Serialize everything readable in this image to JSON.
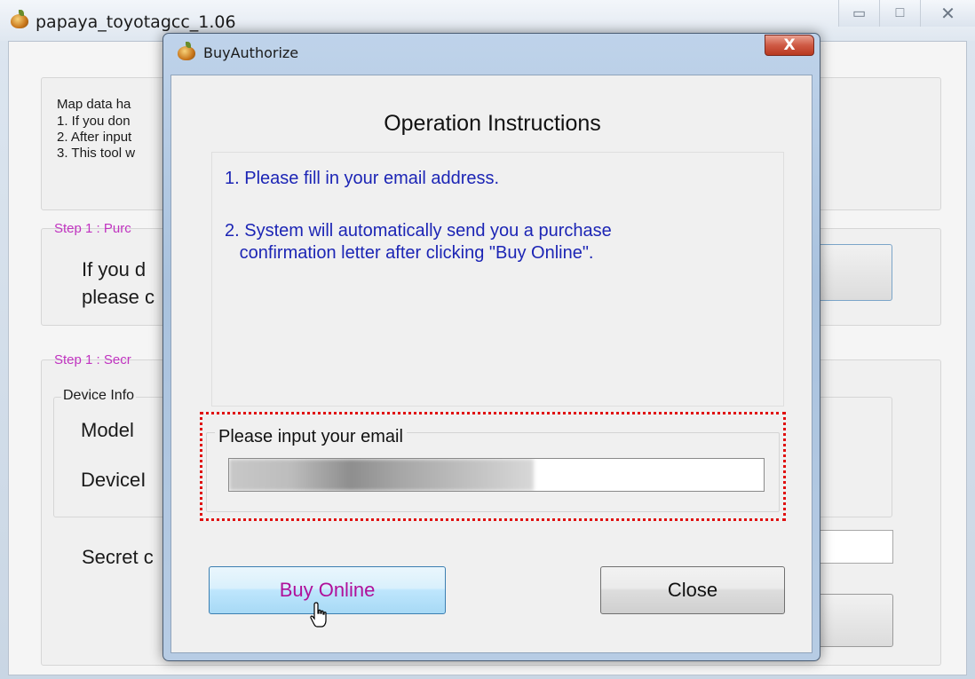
{
  "main_window": {
    "title": "papaya_toyotagcc_1.06",
    "controls": {
      "minimize": "▭",
      "maximize": "□",
      "close": "✕"
    },
    "intro_lines": [
      "Map data ha",
      "1. If you don",
      "2. After input",
      "3. This tool w"
    ],
    "step1_purchase": {
      "label": "Step 1 : Purc",
      "text_line1": "If you d",
      "text_line2": "please c"
    },
    "step1_secret": {
      "label": "Step 1 : Secr"
    },
    "device_info": {
      "label": "Device Info",
      "model_label": "Model",
      "device_id_label": "DeviceI"
    },
    "secret_label": "Secret c"
  },
  "dialog": {
    "title": "BuyAuthorize",
    "close_glyph": "X",
    "heading": "Operation Instructions",
    "instructions": {
      "line1": "1. Please fill in your email address.",
      "line2": "2. System will automatically send you a purchase",
      "line3": "   confirmation letter after clicking \"Buy Online\"."
    },
    "email": {
      "label": "Please input your email",
      "value": ""
    },
    "buttons": {
      "buy_online": "Buy Online",
      "close": "Close"
    }
  },
  "colors": {
    "instruction_text": "#1c25b5",
    "buy_button_text": "#b0109a",
    "highlight_border": "#e01010",
    "step_label": "#c033c0"
  }
}
